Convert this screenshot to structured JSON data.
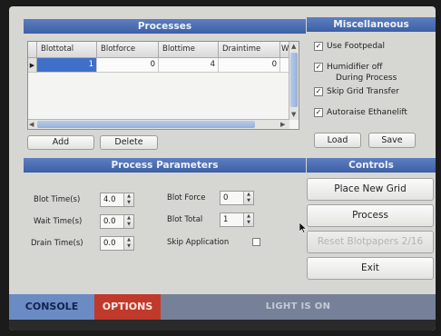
{
  "processes": {
    "title": "Processes",
    "columns": [
      "Blottotal",
      "Blotforce",
      "Blottime",
      "Draintime",
      "W"
    ],
    "rows": [
      {
        "marker": "▶",
        "cells": [
          "1",
          "0",
          "4",
          "0",
          ""
        ]
      }
    ],
    "add_label": "Add",
    "delete_label": "Delete"
  },
  "misc": {
    "title": "Miscellaneous",
    "options": [
      {
        "label": "Use Footpedal",
        "checked": true
      },
      {
        "label": "Humidifier off",
        "label2": "During Process",
        "checked": true
      },
      {
        "label": "Skip Grid Transfer",
        "checked": true
      },
      {
        "label": "Autoraise Ethanelift",
        "checked": true
      }
    ],
    "load_label": "Load",
    "save_label": "Save"
  },
  "params": {
    "title": "Process Parameters",
    "blot_time_label": "Blot Time(s)",
    "blot_time_value": "4.0",
    "wait_time_label": "Wait Time(s)",
    "wait_time_value": "0.0",
    "drain_time_label": "Drain Time(s)",
    "drain_time_value": "0.0",
    "blot_force_label": "Blot Force",
    "blot_force_value": "0",
    "blot_total_label": "Blot Total",
    "blot_total_value": "1",
    "skip_application_label": "Skip Application",
    "skip_application_checked": false
  },
  "controls": {
    "title": "Controls",
    "place_new_grid": "Place New Grid",
    "process": "Process",
    "reset_blotpapers": "Reset Blotpapers 2/16",
    "exit": "Exit"
  },
  "statusbar": {
    "console": "CONSOLE",
    "options": "OPTIONS",
    "light": "LIGHT IS ON"
  },
  "colors": {
    "header_blue": "#4a6db3",
    "options_red": "#c0392b",
    "console_blue": "#6a8bc4",
    "selection_blue": "#3f6fc9"
  }
}
